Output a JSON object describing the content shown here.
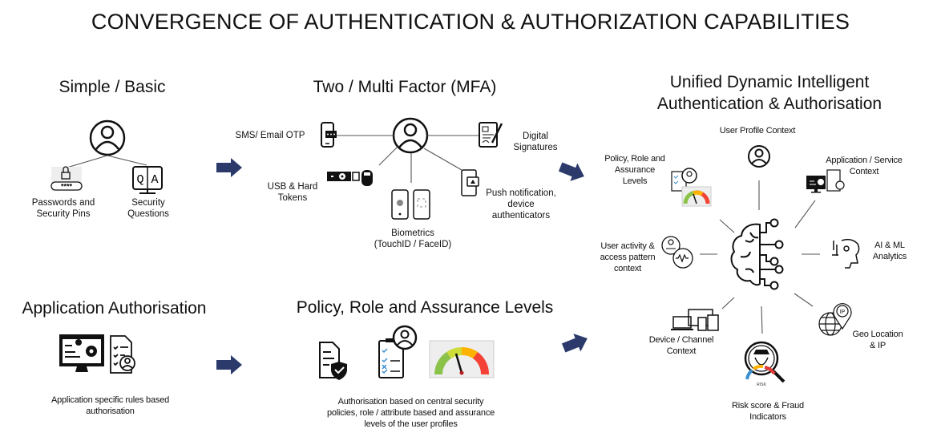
{
  "title": "CONVERGENCE OF AUTHENTICATION & AUTHORIZATION CAPABILITIES",
  "accent_color": "#2b3a6b",
  "sections": {
    "simple_basic": {
      "heading": "Simple  / Basic",
      "items": [
        {
          "label_line1": "Passwords and",
          "label_line2": "Security Pins",
          "icon": "password-lock-icon"
        },
        {
          "label_line1": "Security",
          "label_line2": "Questions",
          "icon": "qa-monitor-icon"
        }
      ]
    },
    "mfa": {
      "heading": "Two / Multi  Factor (MFA)",
      "items": [
        {
          "label_line1": "SMS/ Email OTP",
          "icon": "sms-phone-icon"
        },
        {
          "label_line1": "USB & Hard",
          "label_line2": "Tokens",
          "icon": "usb-token-icon"
        },
        {
          "label_line1": "Biometrics",
          "label_line2": "(TouchID / FaceID)",
          "icon": "biometric-phones-icon"
        },
        {
          "label_line1": "Push notification,",
          "label_line2": "device",
          "label_line3": "authenticators",
          "icon": "push-notification-icon"
        },
        {
          "label_line1": "Digital",
          "label_line2": "Signatures",
          "icon": "digital-signature-icon"
        }
      ]
    },
    "unified": {
      "heading_line1": "Unified  Dynamic  Intelligent",
      "heading_line2": "Authentication  & Authorisation",
      "items": [
        {
          "label_line1": "User Profile Context"
        },
        {
          "label_line1": "Policy, Role and",
          "label_line2": "Assurance",
          "label_line3": "Levels"
        },
        {
          "label_line1": "Application / Service",
          "label_line2": "Context"
        },
        {
          "label_line1": "User activity &",
          "label_line2": "access pattern",
          "label_line3": "context"
        },
        {
          "label_line1": "AI & ML",
          "label_line2": "Analytics"
        },
        {
          "label_line1": "Device / Channel",
          "label_line2": "Context"
        },
        {
          "label_line1": "Risk score & Fraud",
          "label_line2": "Indicators"
        },
        {
          "label_line1": "Geo Location",
          "label_line2": "& IP"
        }
      ],
      "risk_badge": "RISK",
      "ip_badge": "IP"
    },
    "app_authorisation": {
      "heading": "Application  Authorisation",
      "desc_line1": "Application specific rules based",
      "desc_line2": "authorisation"
    },
    "policy_role": {
      "heading": "Policy, Role and Assurance Levels",
      "desc_line1": "Authorisation based on central security",
      "desc_line2": "policies, role / attribute based and assurance",
      "desc_line3": "levels of the user profiles"
    }
  },
  "token_mask": "****"
}
